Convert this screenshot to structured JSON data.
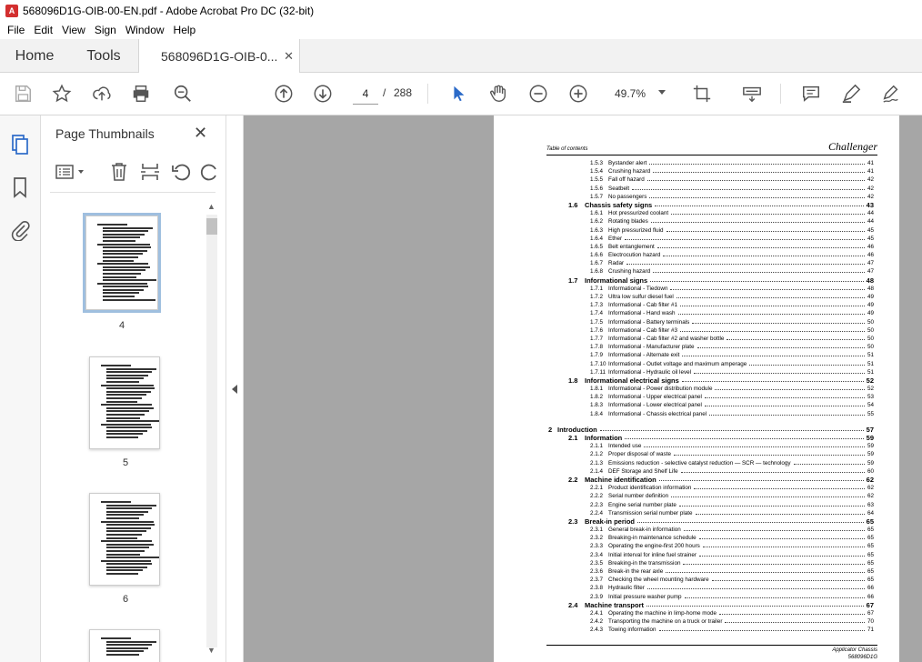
{
  "window": {
    "title": "568096D1G-OIB-00-EN.pdf - Adobe Acrobat Pro DC (32-bit)"
  },
  "menu": [
    "File",
    "Edit",
    "View",
    "Sign",
    "Window",
    "Help"
  ],
  "tabs": {
    "home": "Home",
    "tools": "Tools",
    "document": "568096D1G-OIB-0..."
  },
  "toolbar": {
    "current_page": "4",
    "page_separator": "/",
    "total_pages": "288",
    "zoom": "49.7%"
  },
  "panel": {
    "title": "Page Thumbnails"
  },
  "thumbnails": [
    {
      "label": "4",
      "selected": true
    },
    {
      "label": "5",
      "selected": false
    },
    {
      "label": "6",
      "selected": false
    }
  ],
  "pdf": {
    "header_left": "Table of contents",
    "logo": "Challenger",
    "footer_line1": "Applicator Chassis",
    "footer_line2": "568096D1G",
    "toc": [
      {
        "level": 3,
        "num": "1.5.3",
        "title": "Bystander alert",
        "page": "41"
      },
      {
        "level": 3,
        "num": "1.5.4",
        "title": "Crushing hazard",
        "page": "41"
      },
      {
        "level": 3,
        "num": "1.5.5",
        "title": "Fall off hazard",
        "page": "42"
      },
      {
        "level": 3,
        "num": "1.5.6",
        "title": "Seatbelt",
        "page": "42"
      },
      {
        "level": 3,
        "num": "1.5.7",
        "title": "No passengers",
        "page": "42"
      },
      {
        "level": 2,
        "num": "1.6",
        "title": "Chassis safety signs",
        "page": "43"
      },
      {
        "level": 3,
        "num": "1.6.1",
        "title": "Hot pressurized coolant",
        "page": "44"
      },
      {
        "level": 3,
        "num": "1.6.2",
        "title": "Rotating blades",
        "page": "44"
      },
      {
        "level": 3,
        "num": "1.6.3",
        "title": "High pressurized fluid",
        "page": "45"
      },
      {
        "level": 3,
        "num": "1.6.4",
        "title": "Ether",
        "page": "45"
      },
      {
        "level": 3,
        "num": "1.6.5",
        "title": "Belt entanglement",
        "page": "46"
      },
      {
        "level": 3,
        "num": "1.6.6",
        "title": "Electrocution hazard",
        "page": "46"
      },
      {
        "level": 3,
        "num": "1.6.7",
        "title": "Radar",
        "page": "47"
      },
      {
        "level": 3,
        "num": "1.6.8",
        "title": "Crushing hazard",
        "page": "47"
      },
      {
        "level": 2,
        "num": "1.7",
        "title": "Informational signs",
        "page": "48"
      },
      {
        "level": 3,
        "num": "1.7.1",
        "title": "Informational - Tiedown",
        "page": "48"
      },
      {
        "level": 3,
        "num": "1.7.2",
        "title": "Ultra low sulfur diesel fuel",
        "page": "49"
      },
      {
        "level": 3,
        "num": "1.7.3",
        "title": "Informational - Cab filter #1",
        "page": "49"
      },
      {
        "level": 3,
        "num": "1.7.4",
        "title": "Informational - Hand wash",
        "page": "49"
      },
      {
        "level": 3,
        "num": "1.7.5",
        "title": "Informational - Battery terminals",
        "page": "50"
      },
      {
        "level": 3,
        "num": "1.7.6",
        "title": "Informational - Cab filter #3",
        "page": "50"
      },
      {
        "level": 3,
        "num": "1.7.7",
        "title": "Informational - Cab filter #2 and washer bottle",
        "page": "50"
      },
      {
        "level": 3,
        "num": "1.7.8",
        "title": "Informational - Manufacturer plate",
        "page": "50"
      },
      {
        "level": 3,
        "num": "1.7.9",
        "title": "Informational - Alternate exit",
        "page": "51"
      },
      {
        "level": 3,
        "num": "1.7.10",
        "title": "Informational - Outlet voltage and maximum amperage",
        "page": "51"
      },
      {
        "level": 3,
        "num": "1.7.11",
        "title": "Informational - Hydraulic oil level",
        "page": "51"
      },
      {
        "level": 2,
        "num": "1.8",
        "title": "Informational electrical signs",
        "page": "52"
      },
      {
        "level": 3,
        "num": "1.8.1",
        "title": "Informational - Power distribution module",
        "page": "52"
      },
      {
        "level": 3,
        "num": "1.8.2",
        "title": "Informational - Upper electrical panel",
        "page": "53"
      },
      {
        "level": 3,
        "num": "1.8.3",
        "title": "Informational - Lower electrical panel",
        "page": "54"
      },
      {
        "level": 3,
        "num": "1.8.4",
        "title": "Informational - Chassis electrical panel",
        "page": "55"
      },
      {
        "level": 0,
        "num": "",
        "title": "",
        "page": ""
      },
      {
        "level": 1,
        "num": "2",
        "title": "Introduction",
        "page": "57"
      },
      {
        "level": 2,
        "num": "2.1",
        "title": "Information",
        "page": "59"
      },
      {
        "level": 3,
        "num": "2.1.1",
        "title": "Intended use",
        "page": "59"
      },
      {
        "level": 3,
        "num": "2.1.2",
        "title": "Proper disposal of waste",
        "page": "59"
      },
      {
        "level": 3,
        "num": "2.1.3",
        "title": "Emissions reduction - selective catalyst reduction — SCR — technology",
        "page": "59"
      },
      {
        "level": 3,
        "num": "2.1.4",
        "title": "DEF Storage and Shelf Life",
        "page": "60"
      },
      {
        "level": 2,
        "num": "2.2",
        "title": "Machine identification",
        "page": "62"
      },
      {
        "level": 3,
        "num": "2.2.1",
        "title": "Product identification information",
        "page": "62"
      },
      {
        "level": 3,
        "num": "2.2.2",
        "title": "Serial number definition",
        "page": "62"
      },
      {
        "level": 3,
        "num": "2.2.3",
        "title": "Engine serial number plate",
        "page": "63"
      },
      {
        "level": 3,
        "num": "2.2.4",
        "title": "Transmission serial number plate",
        "page": "64"
      },
      {
        "level": 2,
        "num": "2.3",
        "title": "Break-in period",
        "page": "65"
      },
      {
        "level": 3,
        "num": "2.3.1",
        "title": "General break-in information",
        "page": "65"
      },
      {
        "level": 3,
        "num": "2.3.2",
        "title": "Breaking-in maintenance schedule",
        "page": "65"
      },
      {
        "level": 3,
        "num": "2.3.3",
        "title": "Operating the engine-first 200 hours",
        "page": "65"
      },
      {
        "level": 3,
        "num": "2.3.4",
        "title": "Initial interval for inline fuel strainer",
        "page": "65"
      },
      {
        "level": 3,
        "num": "2.3.5",
        "title": "Breaking-in the transmission",
        "page": "65"
      },
      {
        "level": 3,
        "num": "2.3.6",
        "title": "Break-in the rear axle",
        "page": "65"
      },
      {
        "level": 3,
        "num": "2.3.7",
        "title": "Checking the wheel mounting hardware",
        "page": "65"
      },
      {
        "level": 3,
        "num": "2.3.8",
        "title": "Hydraulic filter",
        "page": "66"
      },
      {
        "level": 3,
        "num": "2.3.9",
        "title": "Initial pressure washer pump",
        "page": "66"
      },
      {
        "level": 2,
        "num": "2.4",
        "title": "Machine transport",
        "page": "67"
      },
      {
        "level": 3,
        "num": "2.4.1",
        "title": "Operating the machine in limp-home mode",
        "page": "67"
      },
      {
        "level": 3,
        "num": "2.4.2",
        "title": "Transporting the machine on a truck or trailer",
        "page": "70"
      },
      {
        "level": 3,
        "num": "2.4.3",
        "title": "Towing information",
        "page": "71"
      }
    ]
  },
  "colors": {
    "accent": "#2b6ac8",
    "canvas": "#a6a6a6",
    "selected_thumb": "#9fbfdf"
  },
  "icons": {
    "toolbar": [
      "save-icon",
      "bookmark-star-icon",
      "upload-icon",
      "print-icon",
      "search-zoom-icon",
      "prev-page-icon",
      "next-page-icon",
      "select-pointer-icon",
      "hand-tool-icon",
      "zoom-out-icon",
      "zoom-in-icon",
      "crop-icon",
      "keyboard-icon",
      "comment-icon",
      "highlight-pen-icon",
      "sign-pen-icon"
    ],
    "rail": [
      "pages-icon",
      "bookmark-icon",
      "attachment-icon"
    ],
    "panel": [
      "thumb-options-icon",
      "delete-icon",
      "insert-icon",
      "rotate-left-icon",
      "rotate-right-icon"
    ]
  }
}
